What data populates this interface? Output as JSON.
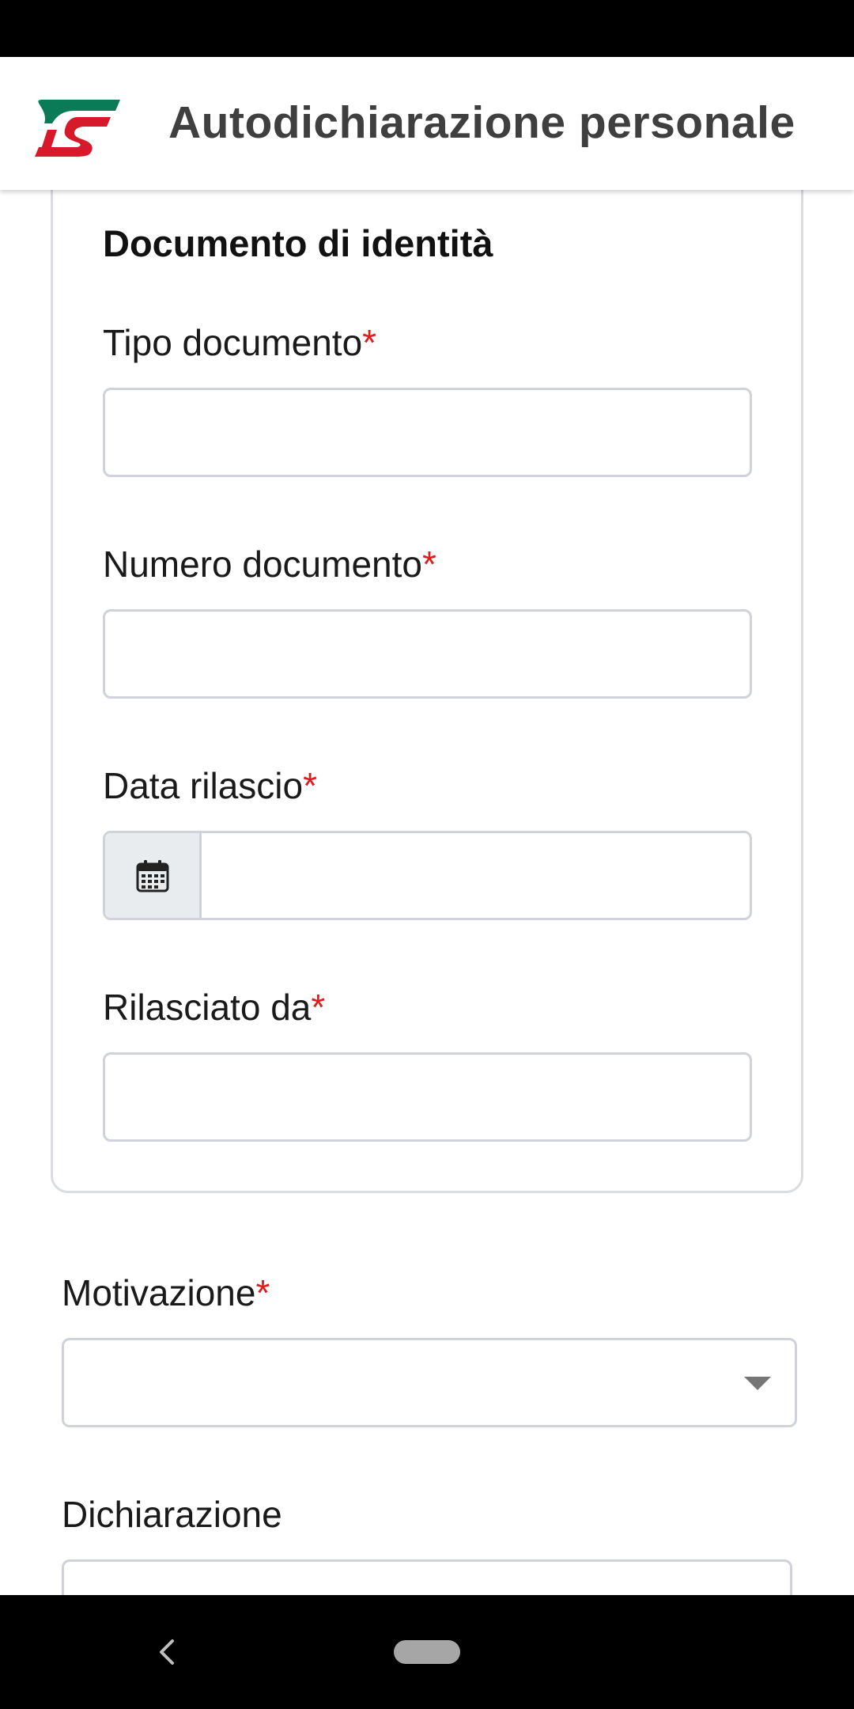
{
  "app": {
    "title": "Autodichiarazione personale",
    "logo_icon": "trenitalia-fs-logo",
    "brand_colors": {
      "green": "#0b7a56",
      "red": "#d61a2c"
    }
  },
  "identity_card": {
    "title": "Documento di identità",
    "fields": {
      "document_type": {
        "label": "Tipo documento",
        "required_marker": "*",
        "value": ""
      },
      "document_number": {
        "label": "Numero documento",
        "required_marker": "*",
        "value": ""
      },
      "issue_date": {
        "label": "Data rilascio",
        "required_marker": "*",
        "value": "",
        "icon": "calendar-icon"
      },
      "issued_by": {
        "label": "Rilasciato da",
        "required_marker": "*",
        "value": ""
      }
    }
  },
  "motivation": {
    "label": "Motivazione",
    "required_marker": "*",
    "selected": ""
  },
  "declaration": {
    "label": "Dichiarazione",
    "value": ""
  },
  "colors": {
    "required": "#e11b1b",
    "border": "#cfd3d9",
    "addon_bg": "#e9ecef"
  },
  "navigation": {
    "back_icon": "back-chevron-icon",
    "home_icon": "home-pill-icon"
  }
}
